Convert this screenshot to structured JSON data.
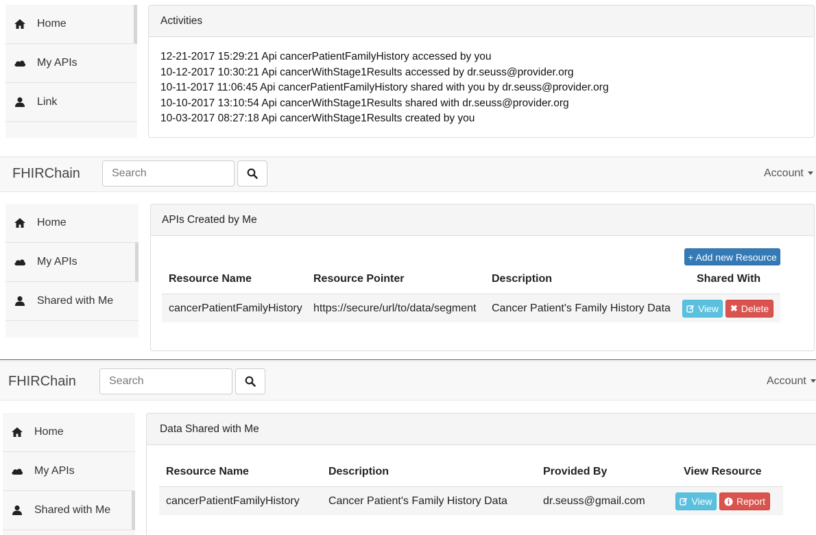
{
  "section1": {
    "sidebar": [
      {
        "icon": "home-icon",
        "label": "Home"
      },
      {
        "icon": "cloud-icon",
        "label": "My APIs"
      },
      {
        "icon": "user-icon",
        "label": "Link"
      }
    ],
    "panel_title": "Activities",
    "activities": [
      "12-21-2017 15:29:21 Api cancerPatientFamilyHistory accessed by you",
      "10-12-2017 10:30:21 Api cancerWithStage1Results accessed by dr.seuss@provider.org",
      "10-11-2017 11:06:45 Api cancerPatientFamilyHistory shared with you by dr.seuss@provider.org",
      "10-10-2017 13:10:54 Api cancerWithStage1Results shared with dr.seuss@provider.org",
      "10-03-2017 08:27:18 Api cancerWithStage1Results created by you"
    ]
  },
  "navbar": {
    "brand": "FHIRChain",
    "search_placeholder": "Search",
    "account": "Account"
  },
  "section2": {
    "sidebar": [
      {
        "icon": "home-icon",
        "label": "Home"
      },
      {
        "icon": "cloud-icon",
        "label": "My APIs"
      },
      {
        "icon": "user-icon",
        "label": "Shared with Me"
      }
    ],
    "panel_title": "APIs Created by Me",
    "add_button": "+ Add new Resource",
    "columns": [
      "Resource Name",
      "Resource Pointer",
      "Description",
      "Shared With"
    ],
    "row": {
      "name": "cancerPatientFamilyHistory",
      "pointer": "https://secure/url/to/data/segment",
      "description": "Cancer Patient's Family History Data",
      "view": "View",
      "delete": "Delete"
    }
  },
  "section3": {
    "sidebar": [
      {
        "icon": "home-icon",
        "label": "Home"
      },
      {
        "icon": "cloud-icon",
        "label": "My APIs"
      },
      {
        "icon": "user-icon",
        "label": "Shared with Me"
      }
    ],
    "panel_title": "Data Shared with Me",
    "columns": [
      "Resource Name",
      "Description",
      "Provided By",
      "View Resource"
    ],
    "row": {
      "name": "cancerPatientFamilyHistory",
      "description": "Cancer Patient's Family History Data",
      "provider": "dr.seuss@gmail.com",
      "view": "View",
      "report": "Report"
    }
  },
  "colors": {
    "info": "#5bc0de",
    "danger": "#d9534f",
    "primary": "#337ab7"
  }
}
